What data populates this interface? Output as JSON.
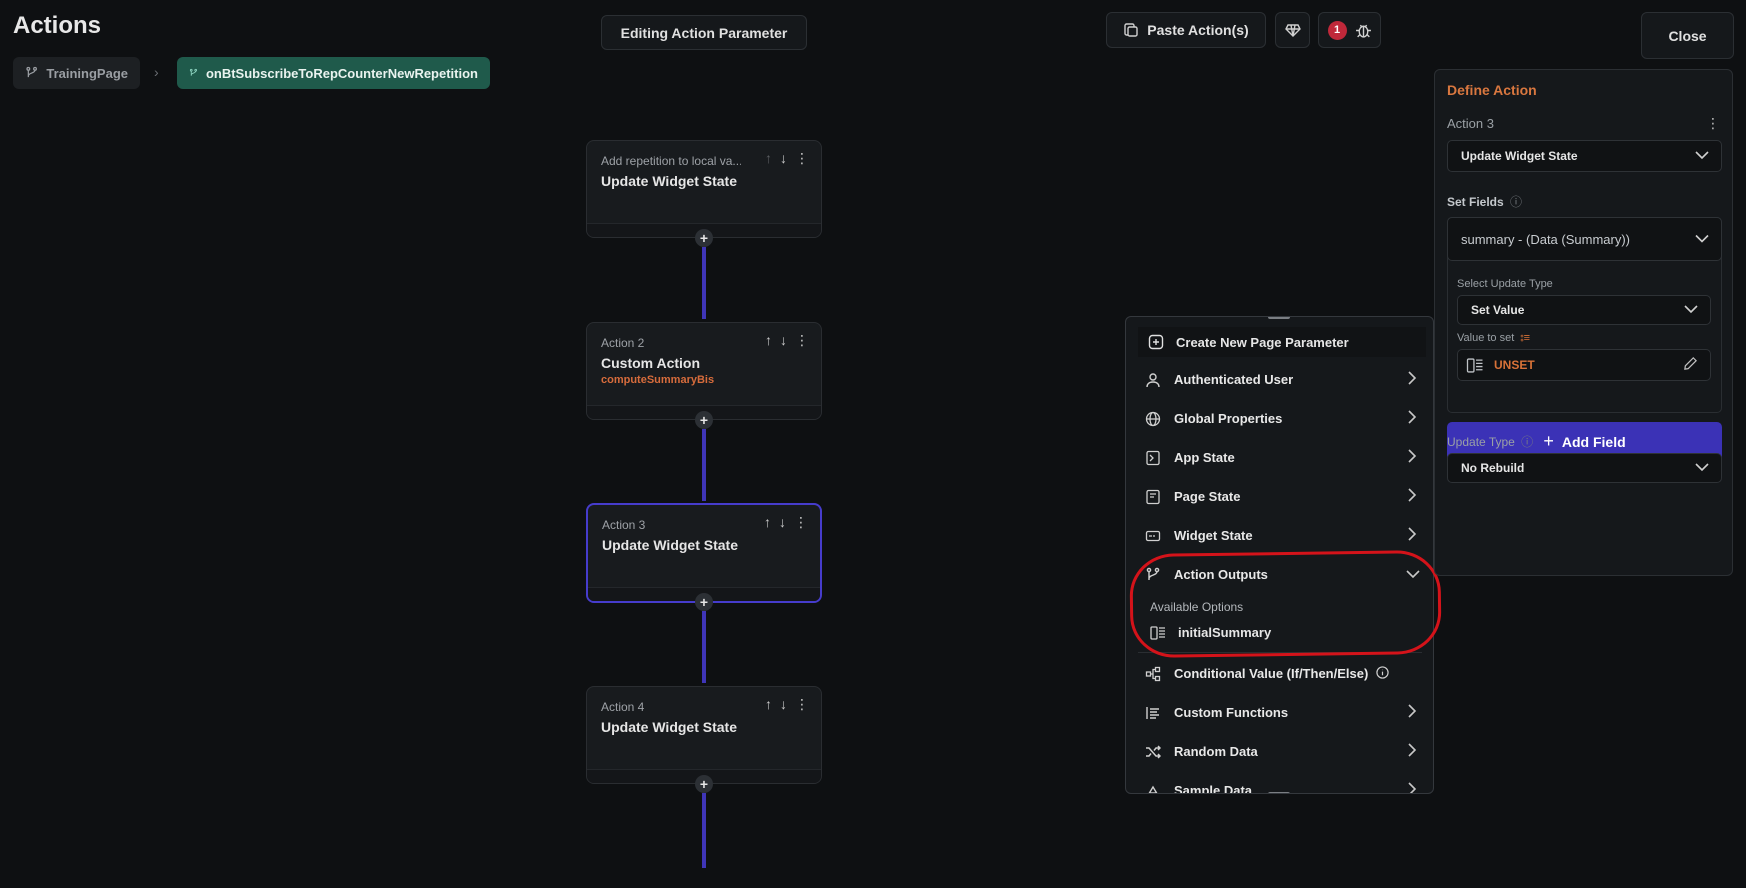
{
  "header": {
    "title": "Actions",
    "editing_label": "Editing Action Parameter",
    "paste_label": "Paste Action(s)",
    "issue_count": "1",
    "close_label": "Close"
  },
  "breadcrumb": {
    "page": "TrainingPage",
    "trigger": "onBtSubscribeToRepCounterNewRepetition"
  },
  "flow": {
    "cards": [
      {
        "label": "Add repetition to local va...",
        "title": "Update Widget State",
        "sub": ""
      },
      {
        "label": "Action 2",
        "title": "Custom Action",
        "sub": "computeSummaryBis"
      },
      {
        "label": "Action 3",
        "title": "Update Widget State",
        "sub": ""
      },
      {
        "label": "Action 4",
        "title": "Update Widget State",
        "sub": ""
      }
    ]
  },
  "dropdown": {
    "create_label": "Create New Page Parameter",
    "items": [
      {
        "label": "Authenticated User",
        "icon": "user-icon"
      },
      {
        "label": "Global Properties",
        "icon": "globe-icon"
      },
      {
        "label": "App State",
        "icon": "app-state-icon"
      },
      {
        "label": "Page State",
        "icon": "page-state-icon"
      },
      {
        "label": "Widget State",
        "icon": "widget-state-icon"
      },
      {
        "label": "Action Outputs",
        "icon": "branch-icon"
      },
      {
        "label": "Conditional Value (If/Then/Else)",
        "icon": "conditional-icon"
      },
      {
        "label": "Custom Functions",
        "icon": "function-icon"
      },
      {
        "label": "Random Data",
        "icon": "shuffle-icon"
      },
      {
        "label": "Sample Data",
        "icon": "sample-icon"
      }
    ],
    "available_options_label": "Available Options",
    "option_label": "initialSummary"
  },
  "define_action": {
    "title": "Define Action",
    "action_label": "Action 3",
    "action_type": "Update Widget State",
    "set_fields_label": "Set Fields",
    "field_value": "summary - (Data (Summary))",
    "update_type_select_label": "Select Update Type",
    "update_type_value": "Set Value",
    "value_to_set_label": "Value to set",
    "value_to_set": "UNSET",
    "add_field_label": "Add Field",
    "update_type_label": "Update Type",
    "update_type_rebuild": "No Rebuild"
  },
  "colors": {
    "accent": "#3b32b6",
    "orange": "#d9773f",
    "highlight": "#d4131a",
    "trigger_bg": "#1f5a4b"
  }
}
